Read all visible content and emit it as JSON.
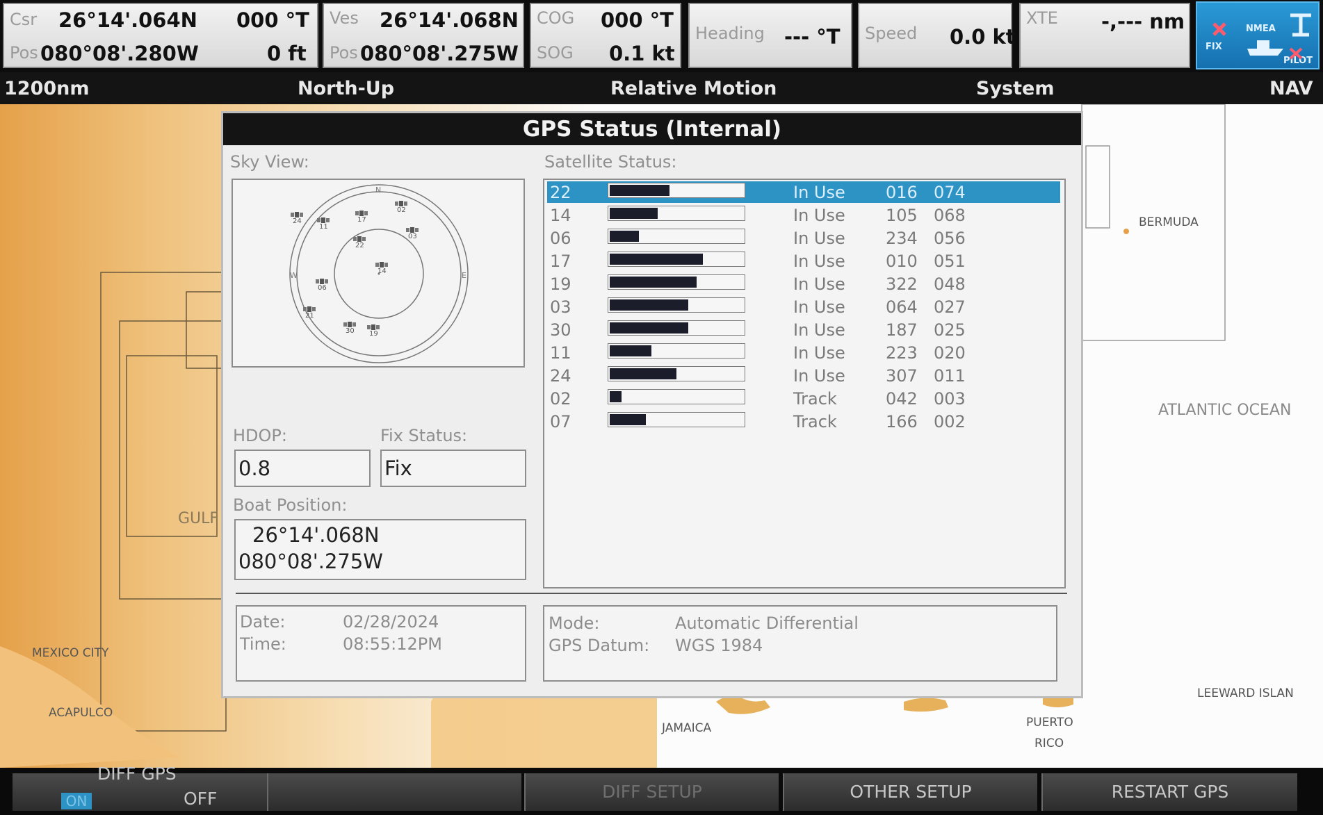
{
  "top": {
    "csr": {
      "label": "Csr",
      "pos_label": "Pos",
      "lat": "26°14'.064N",
      "lon": "080°08'.280W",
      "course": "000 °T",
      "depth": "0 ft"
    },
    "ves": {
      "label": "Ves",
      "pos_label": "Pos",
      "lat": "26°14'.068N",
      "lon": "080°08'.275W"
    },
    "cog": {
      "label": "COG",
      "value": "000 °T"
    },
    "sog": {
      "label": "SOG",
      "value": "0.1 kt"
    },
    "heading": {
      "label": "Heading",
      "value": "--- °T"
    },
    "speed": {
      "label": "Speed",
      "value": "0.0 kt"
    },
    "xte": {
      "label": "XTE",
      "value": "-,--- nm"
    },
    "fix_icon": {
      "name": "gps-fix-status-icon",
      "fix": "FIX",
      "nmea": "NMEA",
      "pilot": "PILOT"
    }
  },
  "modebar": {
    "range": "1200nm",
    "orientation": "North-Up",
    "motion": "Relative Motion",
    "system": "System",
    "nav": "NAV"
  },
  "chart": {
    "places": {
      "bermuda": "BERMUDA",
      "atlantic": "ATLANTIC OCEAN",
      "gulf": "GULF",
      "mexico_city": "MEXICO CITY",
      "acapulco": "ACAPULCO",
      "jamaica": "JAMAICA",
      "puerto": "PUERTO",
      "rico": "RICO",
      "leeward": "LEEWARD ISLAN"
    }
  },
  "dialog": {
    "title": "GPS Status (Internal)",
    "sky_view_label": "Sky View:",
    "satellite_status_label": "Satellite Status:",
    "compass": {
      "n": "N",
      "e": "E",
      "w": "W"
    },
    "sky_sats": [
      "24",
      "11",
      "17",
      "02",
      "03",
      "22",
      "14",
      "06",
      "21",
      "30",
      "19"
    ],
    "hdop_label": "HDOP:",
    "hdop_value": "0.8",
    "fix_label": "Fix Status:",
    "fix_value": "Fix",
    "boat_pos_label": "Boat Position:",
    "boat_lat": "26°14'.068N",
    "boat_lon": "080°08'.275W",
    "date_label": "Date:",
    "date_value": "02/28/2024",
    "time_label": "Time:",
    "time_value": "08:55:12PM",
    "mode_label": "Mode:",
    "mode_value": "Automatic Differential",
    "datum_label": "GPS Datum:",
    "datum_value": "WGS 1984",
    "satellites": [
      {
        "id": "22",
        "signal": 0.45,
        "status": "In Use",
        "azimuth": "016",
        "elevation": "074"
      },
      {
        "id": "14",
        "signal": 0.36,
        "status": "In Use",
        "azimuth": "105",
        "elevation": "068"
      },
      {
        "id": "06",
        "signal": 0.22,
        "status": "In Use",
        "azimuth": "234",
        "elevation": "056"
      },
      {
        "id": "17",
        "signal": 0.7,
        "status": "In Use",
        "azimuth": "010",
        "elevation": "051"
      },
      {
        "id": "19",
        "signal": 0.65,
        "status": "In Use",
        "azimuth": "322",
        "elevation": "048"
      },
      {
        "id": "03",
        "signal": 0.59,
        "status": "In Use",
        "azimuth": "064",
        "elevation": "027"
      },
      {
        "id": "30",
        "signal": 0.59,
        "status": "In Use",
        "azimuth": "187",
        "elevation": "025"
      },
      {
        "id": "11",
        "signal": 0.31,
        "status": "In Use",
        "azimuth": "223",
        "elevation": "020"
      },
      {
        "id": "24",
        "signal": 0.5,
        "status": "In Use",
        "azimuth": "307",
        "elevation": "011"
      },
      {
        "id": "02",
        "signal": 0.09,
        "status": "Track",
        "azimuth": "042",
        "elevation": "003"
      },
      {
        "id": "07",
        "signal": 0.27,
        "status": "Track",
        "azimuth": "166",
        "elevation": "002"
      }
    ]
  },
  "softkeys": {
    "diff_gps": "DIFF GPS",
    "on": "ON",
    "off": "OFF",
    "diff_setup": "DIFF SETUP",
    "other_setup": "OTHER SETUP",
    "restart_gps": "RESTART GPS"
  }
}
